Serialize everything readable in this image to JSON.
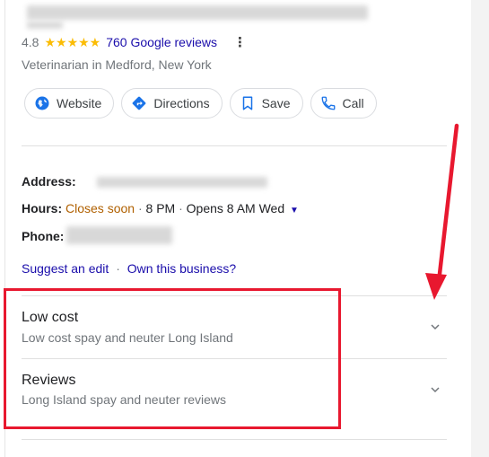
{
  "rating": {
    "value": "4.8",
    "stars": "★★★★★",
    "reviews_link": "760 Google reviews",
    "more": "⋮"
  },
  "category": "Veterinarian in Medford, New York",
  "actions": [
    {
      "label": "Website",
      "icon": "globe-icon"
    },
    {
      "label": "Directions",
      "icon": "directions-icon"
    },
    {
      "label": "Save",
      "icon": "bookmark-icon"
    },
    {
      "label": "Call",
      "icon": "phone-icon"
    }
  ],
  "info": {
    "address_label": "Address:",
    "hours_label": "Hours:",
    "hours_status": "Closes soon",
    "hours_close": "8 PM",
    "hours_open": "Opens 8 AM Wed",
    "phone_label": "Phone:"
  },
  "links": {
    "suggest_edit": "Suggest an edit",
    "separator": "·",
    "own_business": "Own this business?"
  },
  "expanders": [
    {
      "title": "Low cost",
      "subtitle": "Low cost spay and neuter Long Island"
    },
    {
      "title": "Reviews",
      "subtitle": "Long Island spay and neuter reviews"
    }
  ],
  "colors": {
    "annotation_red": "#e8182f",
    "link_blue": "#1a0dab",
    "star_yellow": "#fbbc04",
    "closes_orange": "#b06000"
  }
}
